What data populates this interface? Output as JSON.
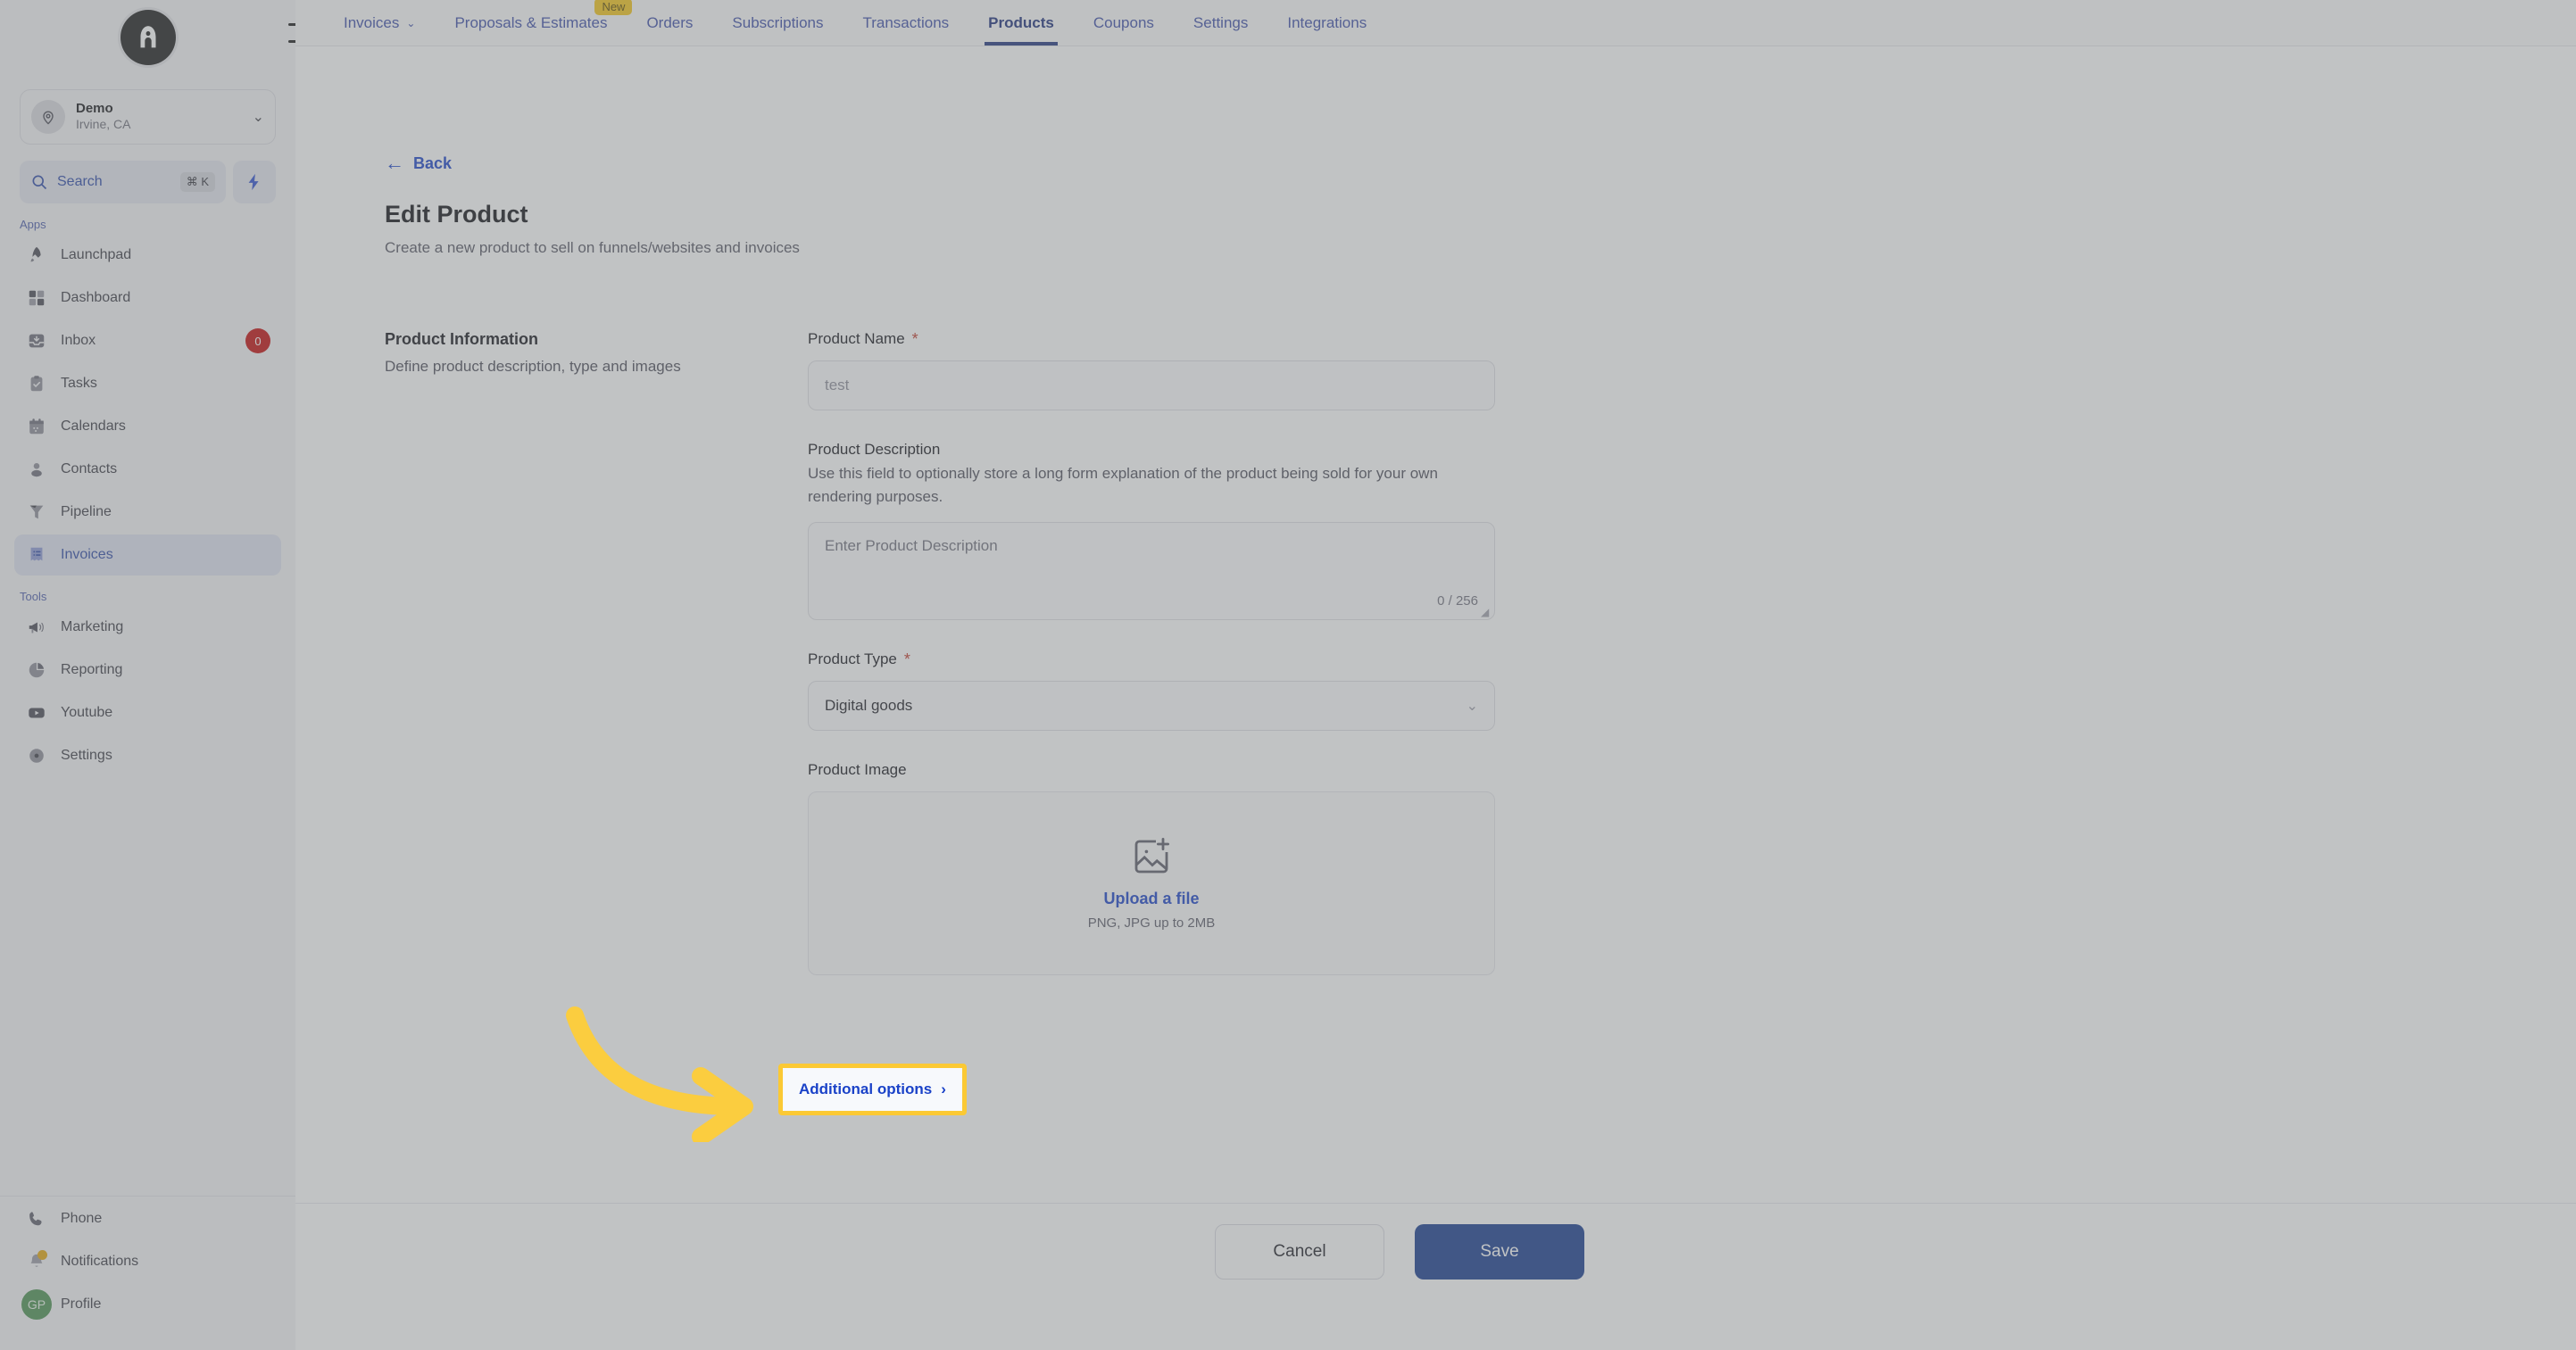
{
  "brand": {
    "logo_letter": "A",
    "logo_name": "app-logo"
  },
  "sidebar": {
    "location": {
      "name": "Demo",
      "sub": "Irvine, CA"
    },
    "search": {
      "label": "Search",
      "shortcut": "⌘ K"
    },
    "sections": [
      {
        "title": "Apps"
      },
      {
        "title": "Tools"
      }
    ],
    "apps_title": "Apps",
    "tools_title": "Tools",
    "apps": [
      {
        "label": "Launchpad",
        "icon": "rocket-icon",
        "badge": ""
      },
      {
        "label": "Dashboard",
        "icon": "grid-icon",
        "badge": ""
      },
      {
        "label": "Inbox",
        "icon": "inbox-icon",
        "badge": "0"
      },
      {
        "label": "Tasks",
        "icon": "clipboard-check-icon",
        "badge": ""
      },
      {
        "label": "Calendars",
        "icon": "calendar-icon",
        "badge": ""
      },
      {
        "label": "Contacts",
        "icon": "user-icon",
        "badge": ""
      },
      {
        "label": "Pipeline",
        "icon": "funnel-icon",
        "badge": ""
      },
      {
        "label": "Invoices",
        "icon": "invoice-icon",
        "badge": "",
        "active": true
      }
    ],
    "tools": [
      {
        "label": "Marketing",
        "icon": "megaphone-icon"
      },
      {
        "label": "Reporting",
        "icon": "pie-chart-icon"
      },
      {
        "label": "Youtube",
        "icon": "youtube-icon"
      },
      {
        "label": "Settings",
        "icon": "gear-icon"
      }
    ],
    "bottom": [
      {
        "label": "Phone",
        "icon": "phone-icon"
      },
      {
        "label": "Notifications",
        "icon": "bell-icon"
      },
      {
        "label": "Profile",
        "icon": "avatar",
        "initials": "GP"
      }
    ]
  },
  "topbar": {
    "tabs": [
      {
        "label": "Invoices",
        "caret": "⌄",
        "badge": ""
      },
      {
        "label": "Proposals & Estimates",
        "badge": "New"
      },
      {
        "label": "Orders",
        "badge": ""
      },
      {
        "label": "Subscriptions",
        "badge": ""
      },
      {
        "label": "Transactions",
        "badge": ""
      },
      {
        "label": "Products",
        "badge": "",
        "active": true
      },
      {
        "label": "Coupons",
        "badge": ""
      },
      {
        "label": "Settings",
        "badge": ""
      },
      {
        "label": "Integrations",
        "badge": ""
      }
    ]
  },
  "page": {
    "back_label": "Back",
    "title": "Edit Product",
    "subtitle": "Create a new product to sell on funnels/websites and invoices"
  },
  "form": {
    "section": {
      "title": "Product Information",
      "description": "Define product description, type and images"
    },
    "product_name": {
      "label": "Product Name",
      "required": "*",
      "value": "test",
      "placeholder": "test"
    },
    "product_description": {
      "label": "Product Description",
      "help": "Use this field to optionally store a long form explanation of the product being sold for your own rendering purposes.",
      "placeholder": "Enter Product Description",
      "char_count": "0 / 256"
    },
    "product_type": {
      "label": "Product Type",
      "required": "*",
      "value": "Digital goods"
    },
    "product_image": {
      "label": "Product Image",
      "upload_link": "Upload a file",
      "hint": "PNG, JPG up to 2MB"
    },
    "additional_options": {
      "label": "Additional options",
      "chevron": "›"
    },
    "cancel_label": "Cancel",
    "save_label": "Save"
  },
  "colors": {
    "accent_blue": "#1a42c8",
    "save_blue": "#173b8f",
    "highlight_yellow": "#fbc934",
    "badge_red": "#c40b0b",
    "badge_new": "#f5c518",
    "avatar_green": "#4c9050"
  }
}
